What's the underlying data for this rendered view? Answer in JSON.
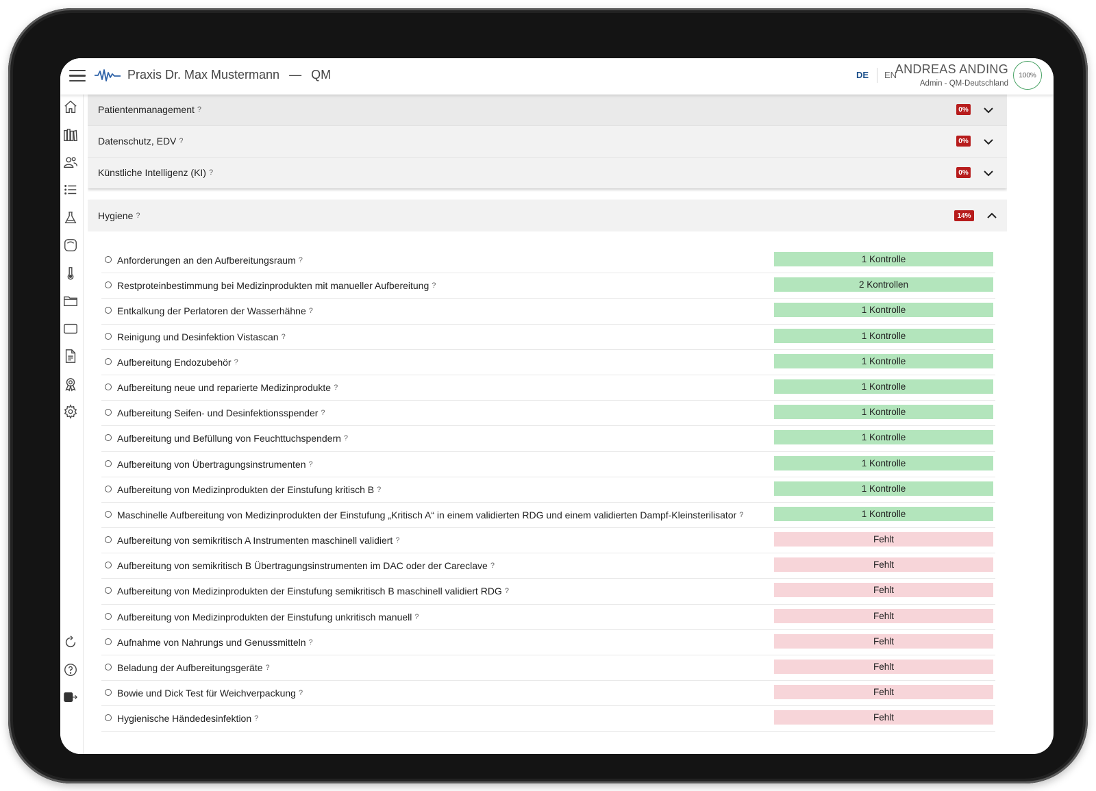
{
  "header": {
    "practice": "Praxis Dr. Max Mustermann",
    "separator": "—",
    "module": "QM",
    "lang_de": "DE",
    "lang_en": "EN",
    "user_name": "ANDREAS ANDING",
    "user_role": "Admin - QM-Deutschland",
    "progress": "100%"
  },
  "sidebar": {
    "icons": [
      "home-icon",
      "library-icon",
      "users-icon",
      "list-icon",
      "flask-icon",
      "device-icon",
      "thermometer-icon",
      "folder-icon",
      "tablet-icon",
      "document-icon",
      "award-icon",
      "gear-icon",
      "refresh-icon",
      "help-icon",
      "logout-icon"
    ]
  },
  "sections": [
    {
      "label": "Patientenmanagement",
      "badge": "0%"
    },
    {
      "label": "Datenschutz, EDV",
      "badge": "0%"
    },
    {
      "label": "Künstliche Intelligenz (KI)",
      "badge": "0%"
    }
  ],
  "hygiene": {
    "label": "Hygiene",
    "badge": "14%",
    "items": [
      {
        "text": "Anforderungen an den Aufbereitungsraum",
        "status": "1 Kontrolle",
        "state": "ok"
      },
      {
        "text": "Restproteinbestimmung bei Medizinprodukten mit manueller Aufbereitung",
        "status": "2 Kontrollen",
        "state": "ok"
      },
      {
        "text": "Entkalkung der Perlatoren der Wasserhähne",
        "status": "1 Kontrolle",
        "state": "ok"
      },
      {
        "text": "Reinigung und Desinfektion Vistascan",
        "status": "1 Kontrolle",
        "state": "ok"
      },
      {
        "text": "Aufbereitung Endozubehör",
        "status": "1 Kontrolle",
        "state": "ok"
      },
      {
        "text": "Aufbereitung neue und reparierte Medizinprodukte",
        "status": "1 Kontrolle",
        "state": "ok"
      },
      {
        "text": "Aufbereitung Seifen- und Desinfektionsspender",
        "status": "1 Kontrolle",
        "state": "ok"
      },
      {
        "text": "Aufbereitung und Befüllung von Feuchttuchspendern",
        "status": "1 Kontrolle",
        "state": "ok"
      },
      {
        "text": "Aufbereitung von Übertragungsinstrumenten",
        "status": "1 Kontrolle",
        "state": "ok"
      },
      {
        "text": "Aufbereitung von Medizinprodukten der Einstufung kritisch B",
        "status": "1 Kontrolle",
        "state": "ok"
      },
      {
        "text": "Maschinelle Aufbereitung von Medizinprodukten der Einstufung „Kritisch A“ in einem validierten RDG und einem validierten Dampf-Kleinsterilisator",
        "status": "1 Kontrolle",
        "state": "ok"
      },
      {
        "text": "Aufbereitung von semikritisch A Instrumenten maschinell validiert",
        "status": "Fehlt",
        "state": "missing"
      },
      {
        "text": "Aufbereitung von semikritisch B Übertragungsinstrumenten im DAC oder der Careclave",
        "status": "Fehlt",
        "state": "missing"
      },
      {
        "text": "Aufbereitung von Medizinprodukten der Einstufung semikritisch B maschinell validiert RDG",
        "status": "Fehlt",
        "state": "missing"
      },
      {
        "text": "Aufbereitung von Medizinprodukten der Einstufung unkritisch manuell",
        "status": "Fehlt",
        "state": "missing"
      },
      {
        "text": "Aufnahme von Nahrungs und Genussmitteln",
        "status": "Fehlt",
        "state": "missing"
      },
      {
        "text": "Beladung der Aufbereitungsgeräte",
        "status": "Fehlt",
        "state": "missing"
      },
      {
        "text": "Bowie und Dick Test für Weichverpackung",
        "status": "Fehlt",
        "state": "missing"
      },
      {
        "text": "Hygienische Händedesinfektion",
        "status": "Fehlt",
        "state": "missing"
      }
    ]
  },
  "help_glyph": "?",
  "colors": {
    "ok": "#b3e5bc",
    "missing": "#f7d5d9",
    "badge": "#b71c1c",
    "accent": "#1a4f8b"
  }
}
